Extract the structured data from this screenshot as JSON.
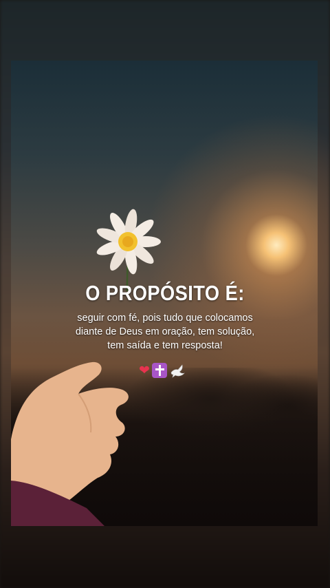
{
  "colors": {
    "sun": "#ffe8b8",
    "text": "#ffffff",
    "heart": "#e8334f",
    "cross_bg": "#a855c7"
  },
  "quote": {
    "title": "O PROPÓSITO É:",
    "lines": [
      "seguir com fé, pois tudo que colocamos",
      "diante de Deus em oração, tem solução,",
      "tem saída e tem resposta!"
    ]
  },
  "icons": [
    "heart-icon",
    "latin-cross-icon",
    "dove-icon"
  ]
}
